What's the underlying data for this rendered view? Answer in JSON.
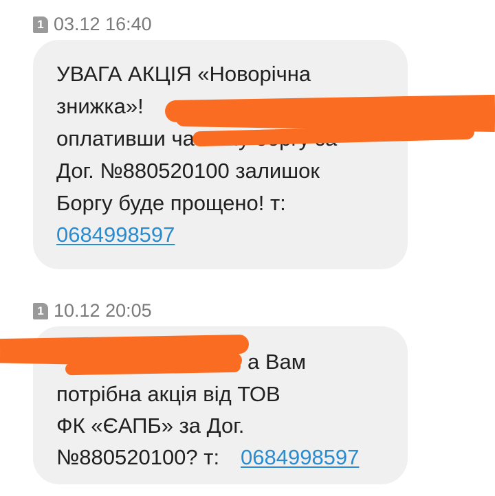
{
  "messages": [
    {
      "sim": "1",
      "timestamp": "03.12 16:40",
      "lines": [
        "УВАГА АКЦІЯ «Новорічна",
        "знижка»!",
        "оплативши частину боргу за",
        "Дог. №880520100 залишок",
        "Боргу буде прощено! т:"
      ],
      "phone_link": "0684998597"
    },
    {
      "sim": "1",
      "timestamp": "10.12 20:05",
      "lines": [
        "а Вам",
        "потрібна акція від ТОВ",
        "ФК «ЄАПБ» за Дог.",
        "№880520100? т:"
      ],
      "phone_link": "0684998597"
    }
  ],
  "colors": {
    "bubble_bg": "#f0f0f0",
    "link": "#2a8ccf",
    "redaction": "#fb6c23",
    "timestamp": "#7a7a7a"
  }
}
